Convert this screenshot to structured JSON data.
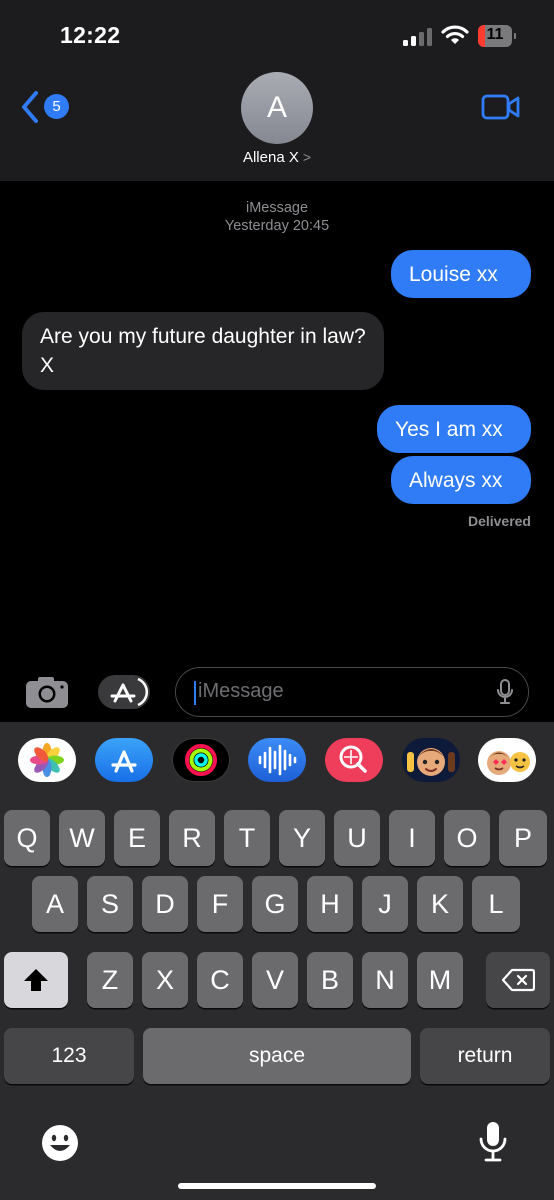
{
  "status_bar": {
    "time": "12:22",
    "battery": "11"
  },
  "nav": {
    "unread_count": "5",
    "avatar_initial": "A",
    "contact_name": "Allena X",
    "chevron": ">"
  },
  "thread": {
    "service": "iMessage",
    "timestamp": "Yesterday 20:45",
    "messages": [
      {
        "direction": "sent",
        "text": "Louise xx"
      },
      {
        "direction": "received",
        "text": "Are you my future daughter in law? X"
      },
      {
        "direction": "sent",
        "text": "Yes I am xx"
      },
      {
        "direction": "sent",
        "text": "Always xx"
      }
    ],
    "status": "Delivered"
  },
  "composer": {
    "placeholder": "iMessage"
  },
  "app_strip": [
    "photos-icon",
    "app-store-icon",
    "activity-icon",
    "audio-message-icon",
    "web-search-icon",
    "memoji-icon",
    "memoji-stickers-icon"
  ],
  "keyboard": {
    "row1": [
      "Q",
      "W",
      "E",
      "R",
      "T",
      "Y",
      "U",
      "I",
      "O",
      "P"
    ],
    "row2": [
      "A",
      "S",
      "D",
      "F",
      "G",
      "H",
      "J",
      "K",
      "L"
    ],
    "row3": [
      "Z",
      "X",
      "C",
      "V",
      "B",
      "N",
      "M"
    ],
    "numbers_label": "123",
    "space_label": "space",
    "return_label": "return"
  },
  "colors": {
    "accent": "#2f7cf6",
    "header_bg": "#1c1c1e",
    "received_bubble": "#262628",
    "key_bg": "#6b6b6e",
    "battery_low": "#ff3b30"
  }
}
